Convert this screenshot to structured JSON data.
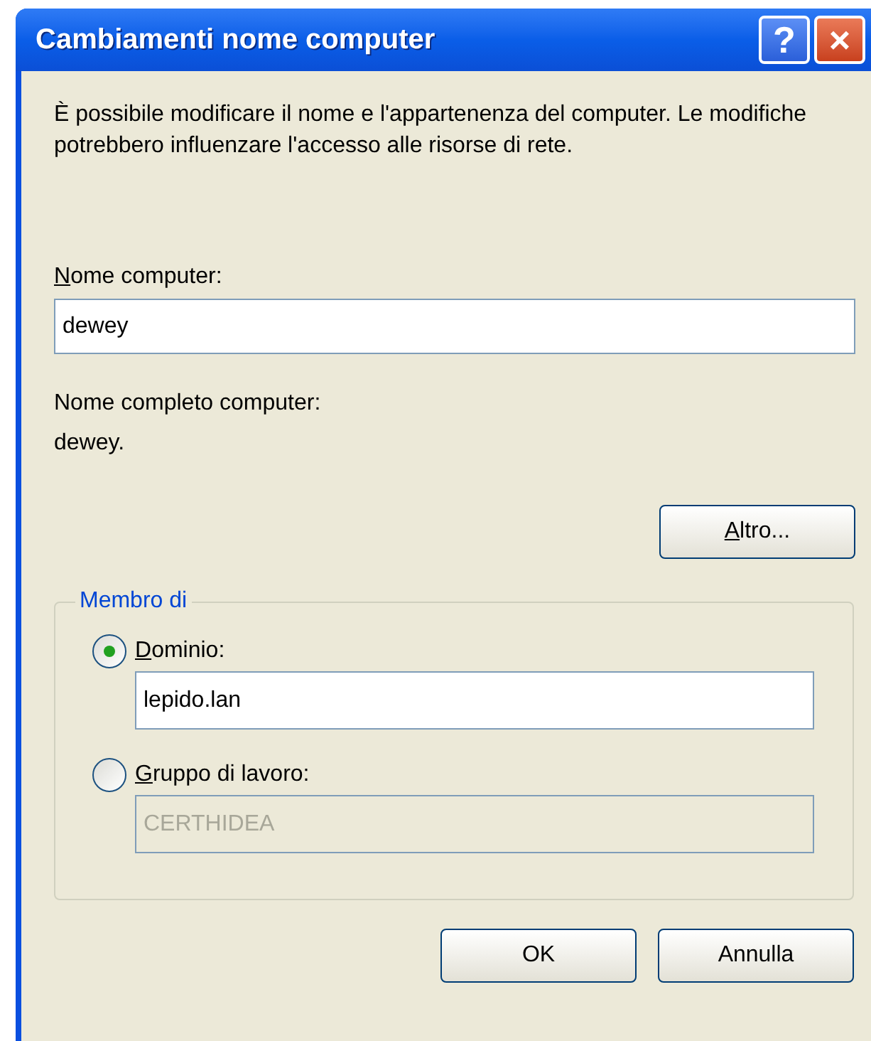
{
  "window": {
    "title": "Cambiamenti nome computer",
    "title_buttons": [
      {
        "kind": "help",
        "label": "?"
      },
      {
        "kind": "close",
        "label": "×"
      }
    ]
  },
  "description": "È possibile modificare il nome e l'appartenenza del computer. Le modifiche potrebbero influenzare l'accesso alle risorse di rete.",
  "computer_name": {
    "label": "Nome computer:",
    "access_key_underlined": true,
    "value": "dewey"
  },
  "full_name": {
    "label": "Nome completo computer:",
    "value": "dewey."
  },
  "more_button": {
    "label": "Altro...",
    "access_key_underlined": true
  },
  "member_of": {
    "legend": "Membro di",
    "options": [
      {
        "label": "Dominio:",
        "access_key_underlined": true,
        "selected": true,
        "value": "lepido.lan",
        "disabled": false
      },
      {
        "label": "Gruppo di lavoro:",
        "access_key_underlined": true,
        "selected": false,
        "value": "CERTHIDEA",
        "disabled": true
      }
    ]
  },
  "buttons": [
    {
      "label": "OK"
    },
    {
      "label": "Annulla"
    }
  ]
}
